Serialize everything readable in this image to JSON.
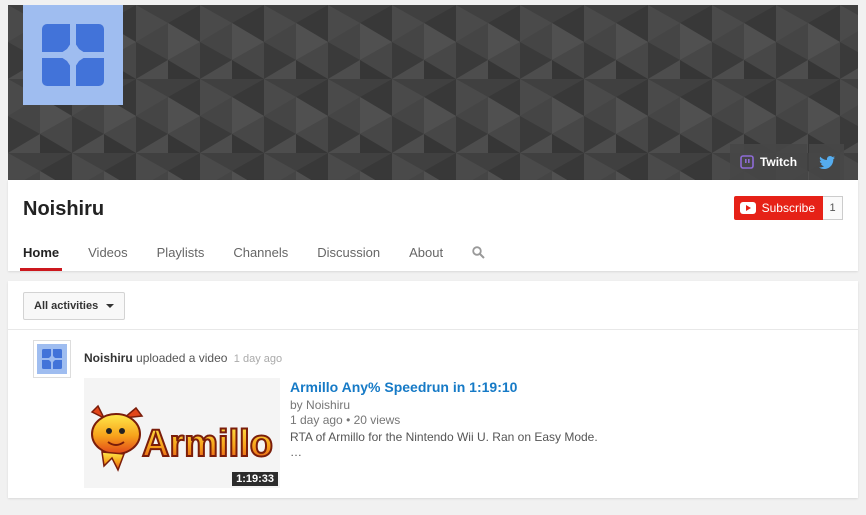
{
  "banner": {
    "links": [
      {
        "label": "Twitch",
        "icon": "twitch-icon"
      },
      {
        "label": "",
        "icon": "twitter-icon"
      }
    ]
  },
  "channel": {
    "name": "Noishiru",
    "subscribe_label": "Subscribe",
    "subscriber_count": "1"
  },
  "tabs": [
    {
      "label": "Home",
      "active": true
    },
    {
      "label": "Videos"
    },
    {
      "label": "Playlists"
    },
    {
      "label": "Channels"
    },
    {
      "label": "Discussion"
    },
    {
      "label": "About"
    }
  ],
  "feed": {
    "filter_label": "All activities",
    "activity": {
      "author": "Noishiru",
      "action": "uploaded a video",
      "time": "1 day ago"
    },
    "video": {
      "title": "Armillo Any% Speedrun in 1:19:10",
      "by_prefix": "by",
      "by_author": "Noishiru",
      "age": "1 day ago",
      "separator": "•",
      "views": "20 views",
      "description": "RTA of Armillo for the Nintendo Wii U. Ran on Easy Mode.",
      "more": "…",
      "duration": "1:19:33",
      "thumbnail_logo_text": "Armillo"
    }
  },
  "colors": {
    "brand_red": "#e62117",
    "link_blue": "#167ac6",
    "avatar_blue": "#9fbdf0",
    "avatar_icon_blue": "#4273d9"
  }
}
